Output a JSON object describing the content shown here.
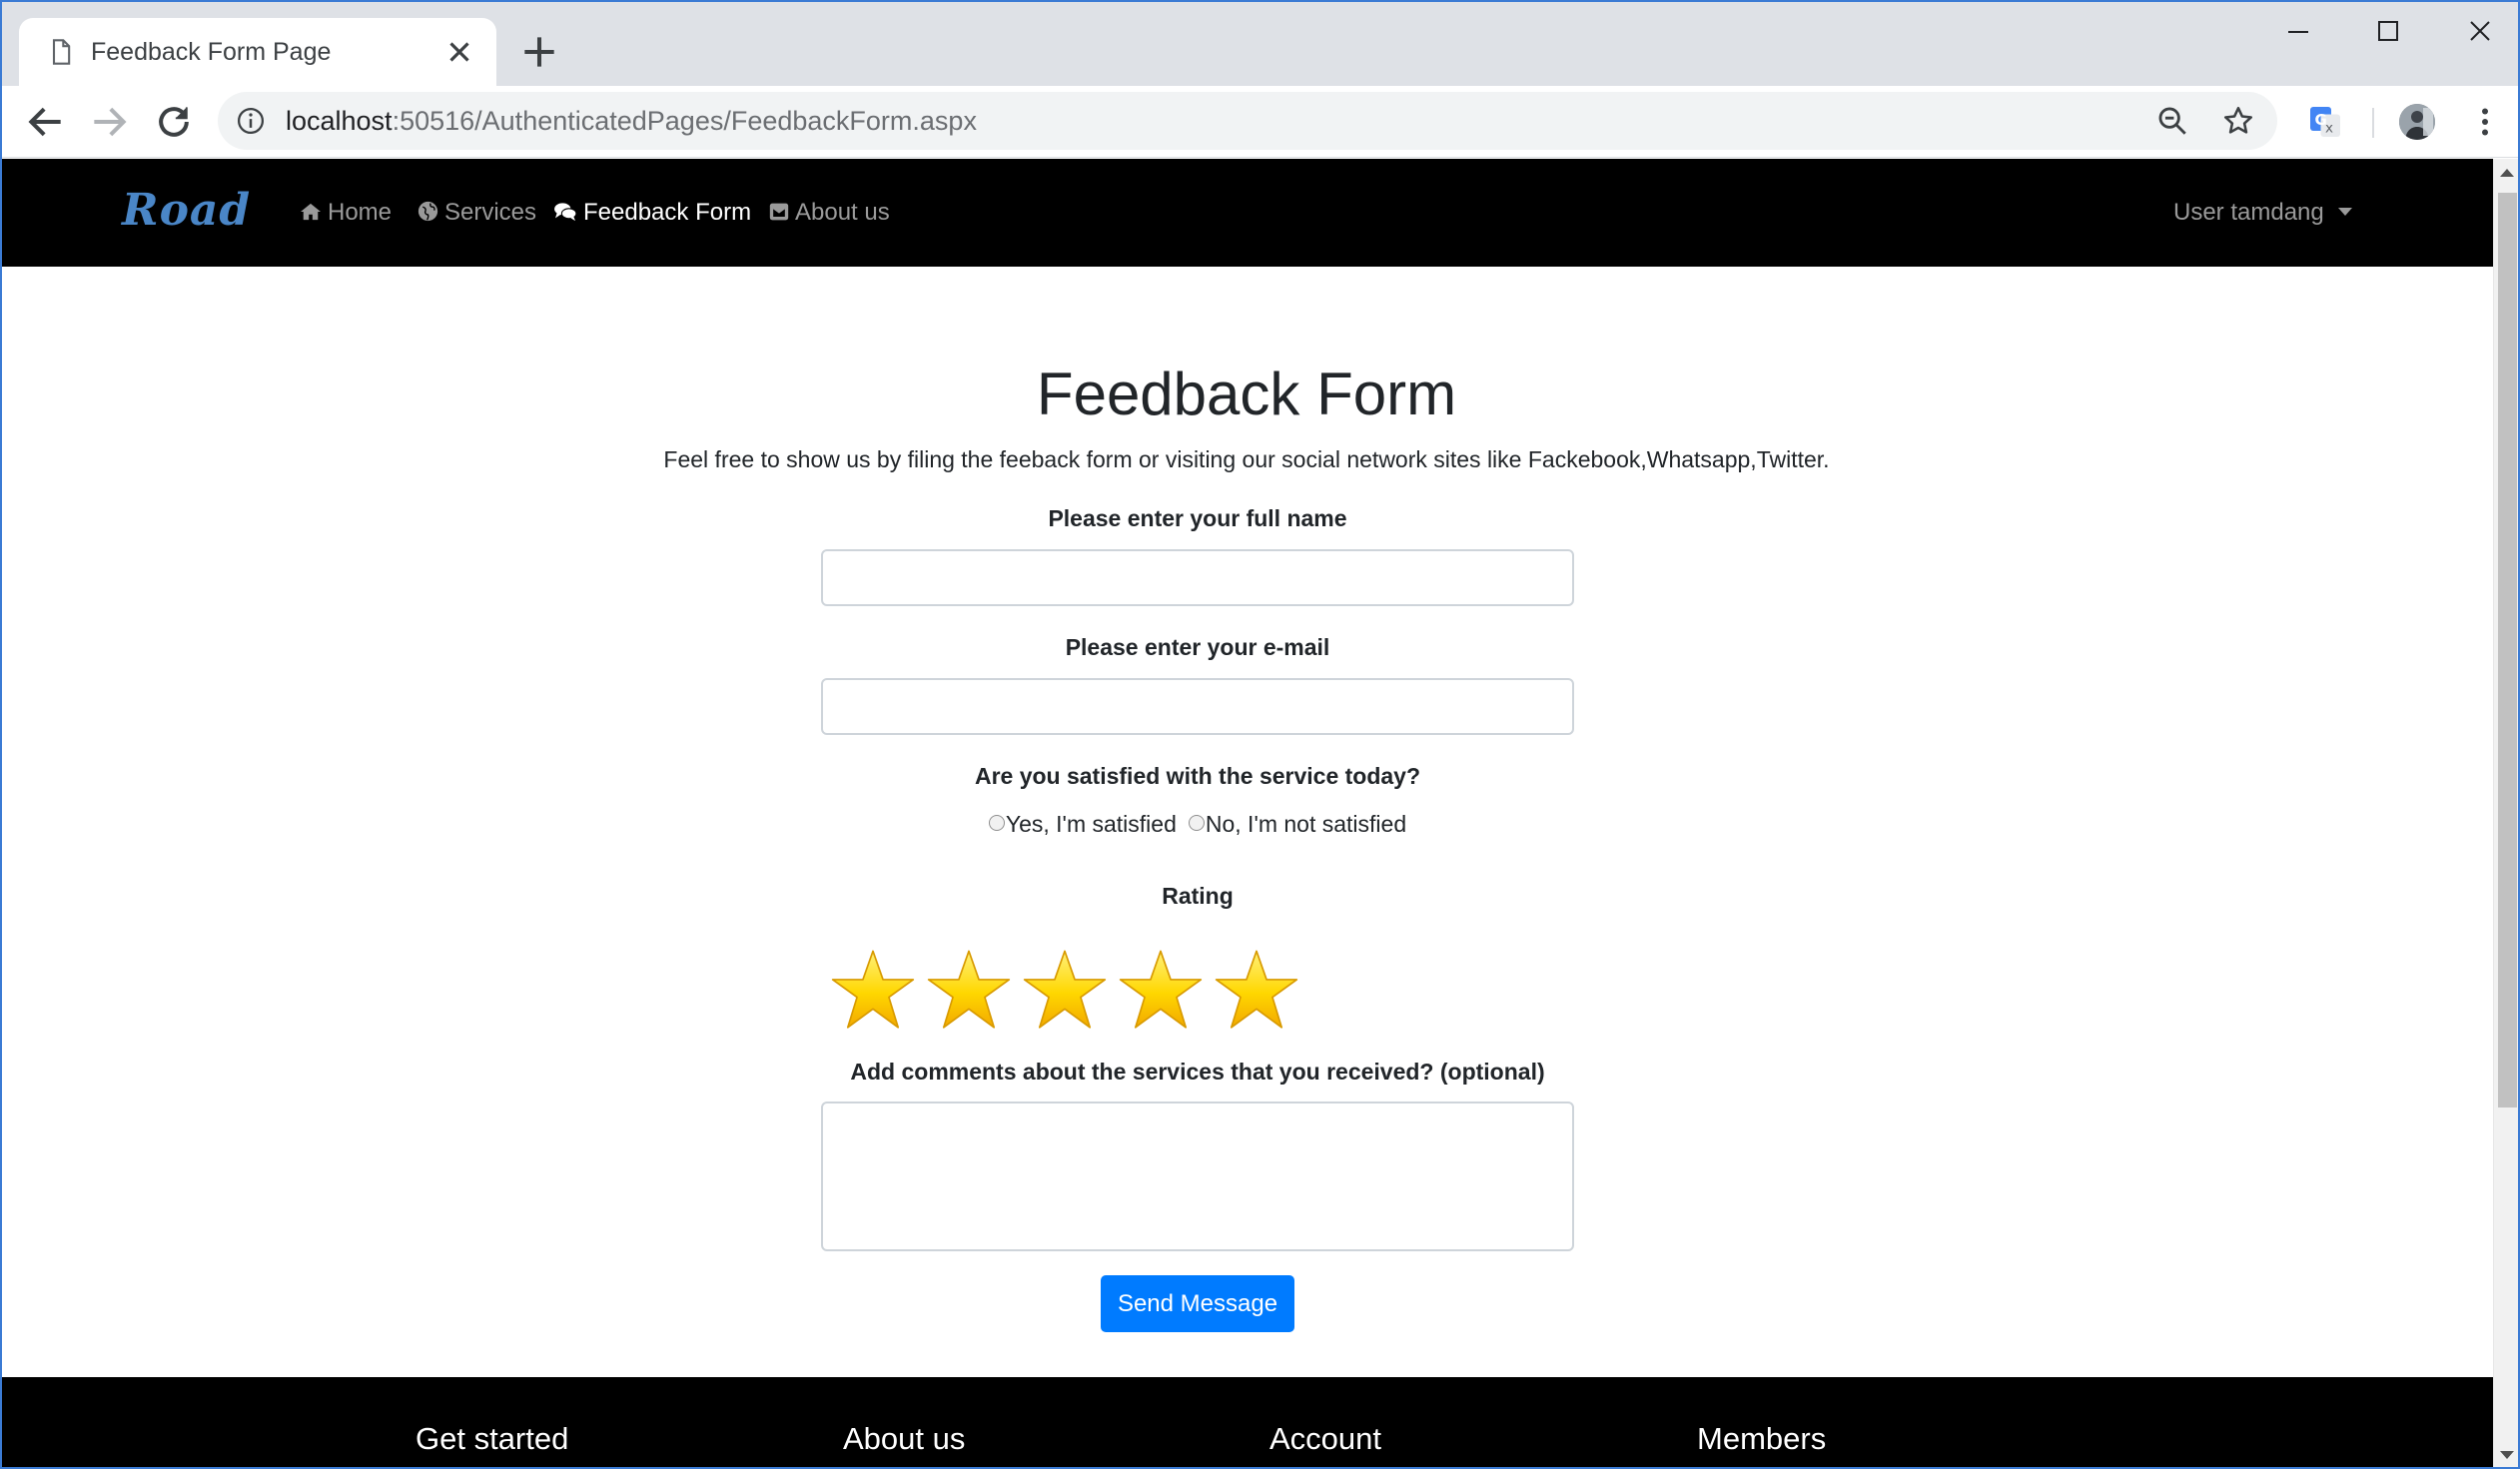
{
  "browser": {
    "tab_title": "Feedback Form Page",
    "url_host": "localhost",
    "url_rest": ":50516/AuthenticatedPages/FeedbackForm.aspx"
  },
  "navbar": {
    "brand": "Road",
    "links": [
      {
        "label": "Home",
        "icon": "home-icon"
      },
      {
        "label": "Services",
        "icon": "globe-icon"
      },
      {
        "label": "Feedback Form",
        "icon": "comments-icon",
        "active": true
      },
      {
        "label": "About us",
        "icon": "envelope-icon"
      }
    ],
    "user_menu": "User tamdang"
  },
  "page": {
    "title": "Feedback Form",
    "subtitle": "Feel free to show us by filing the feeback form or visiting our social network sites like Fackebook,Whatsapp,Twitter."
  },
  "form": {
    "name_label": "Please enter your full name",
    "name_value": "",
    "email_label": "Please enter your e-mail",
    "email_value": "",
    "satisfaction_label": "Are you satisfied with the service today?",
    "satisfaction_options": [
      "Yes, I'm satisfied",
      "No, I'm not satisfied"
    ],
    "satisfaction_selected": null,
    "rating_label": "Rating",
    "rating_stars_shown": 5,
    "comments_label": "Add comments about the services that you received? (optional)",
    "comments_value": "",
    "submit_label": "Send Message"
  },
  "footer": {
    "headings": [
      "Get started",
      "About us",
      "Account",
      "Members"
    ]
  },
  "colors": {
    "navbar_bg": "#000000",
    "brand": "#4a86c7",
    "primary_button": "#007bff",
    "star": "#ffd700"
  }
}
